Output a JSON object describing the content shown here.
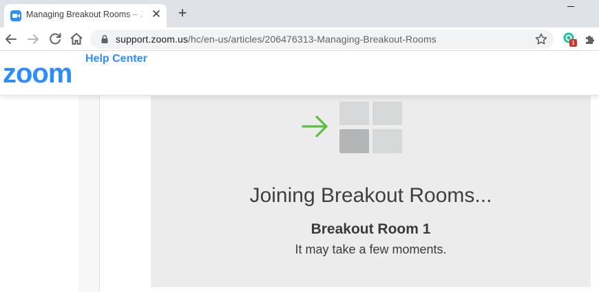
{
  "browser": {
    "tab": {
      "title": "Managing Breakout Rooms – Zoom Help Center",
      "favicon": "zoom-favicon-icon",
      "close_glyph": "✕"
    },
    "new_tab_glyph": "+",
    "address": {
      "host": "support.zoom.us",
      "path": "/hc/en-us/articles/206476313-Managing-Breakout-Rooms"
    },
    "extensions": [
      {
        "name": "grammarly-extension-icon",
        "badge": "1"
      },
      {
        "name": "extensions-puzzle-icon"
      }
    ]
  },
  "site": {
    "logo_text": "zoom",
    "section": "Help Center",
    "brand_color": "#2d8cff"
  },
  "article_image": {
    "arrow_color": "#5bbf3f",
    "joining_title": "Joining Breakout Rooms...",
    "room_name": "Breakout Room 1",
    "wait_message": "It may take a few moments."
  }
}
